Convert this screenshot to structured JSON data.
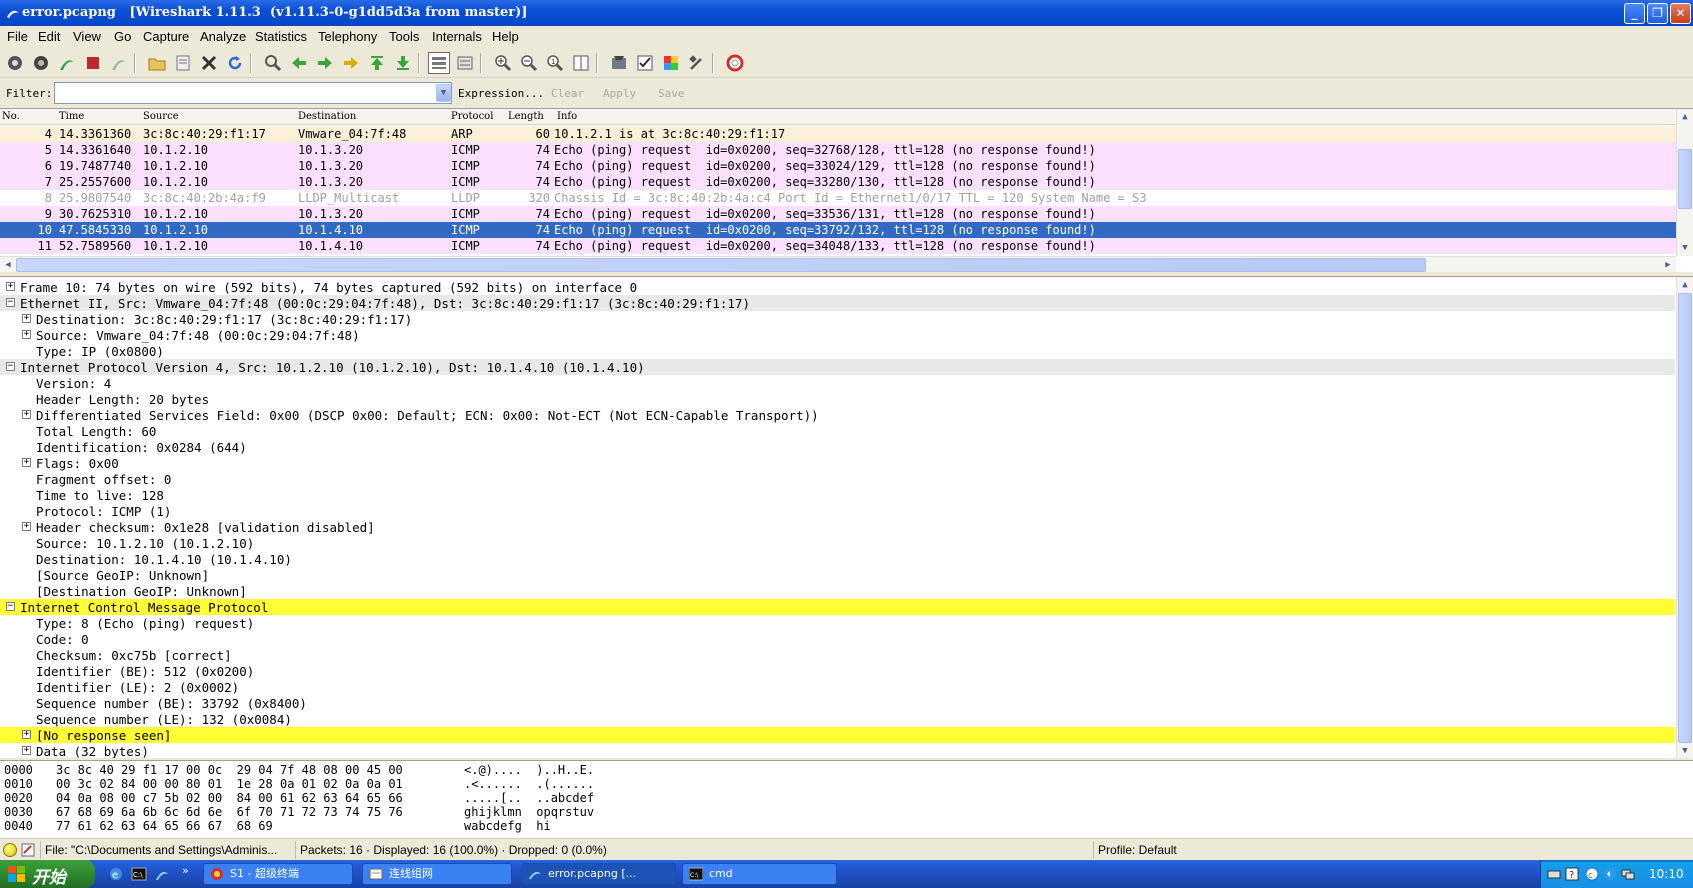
{
  "window": {
    "title": "error.pcapng   [Wireshark 1.11.3  (v1.11.3-0-g1dd5d3a from master)]",
    "controls": [
      "minimize",
      "maximize",
      "close"
    ]
  },
  "menu": [
    "File",
    "Edit",
    "View",
    "Go",
    "Capture",
    "Analyze",
    "Statistics",
    "Telephony",
    "Tools",
    "Internals",
    "Help"
  ],
  "toolbar_icons": [
    "interfaces-icon",
    "options-icon",
    "start-capture-icon",
    "stop-capture-icon",
    "restart-capture-icon",
    "open-file-icon",
    "save-file-icon",
    "close-file-icon",
    "reload-icon",
    "find-packet-icon",
    "go-back-icon",
    "go-forward-icon",
    "go-to-packet-icon",
    "first-packet-icon",
    "last-packet-icon",
    "colorize-icon",
    "auto-scroll-icon",
    "zoom-in-icon",
    "zoom-out-icon",
    "normal-size-icon",
    "resize-columns-icon",
    "capture-filters-icon",
    "display-filters-icon",
    "coloring-rules-icon",
    "preferences-icon",
    "help-icon"
  ],
  "filter": {
    "label": "Filter:",
    "value": "",
    "expression": "Expression...",
    "clear": "Clear",
    "apply": "Apply",
    "save": "Save"
  },
  "packet_list": {
    "columns": [
      "No.",
      "Time",
      "Source",
      "Destination",
      "Protocol",
      "Length",
      "Info"
    ],
    "rows": [
      {
        "no": "4",
        "time": "14.3361360",
        "src": "3c:8c:40:29:f1:17",
        "dst": "Vmware_04:7f:48",
        "proto": "ARP",
        "len": "60",
        "info": "10.1.2.1 is at 3c:8c:40:29:f1:17",
        "kind": "arp"
      },
      {
        "no": "5",
        "time": "14.3361640",
        "src": "10.1.2.10",
        "dst": "10.1.3.20",
        "proto": "ICMP",
        "len": "74",
        "info": "Echo (ping) request  id=0x0200, seq=32768/128, ttl=128 (no response found!)",
        "kind": "icmp"
      },
      {
        "no": "6",
        "time": "19.7487740",
        "src": "10.1.2.10",
        "dst": "10.1.3.20",
        "proto": "ICMP",
        "len": "74",
        "info": "Echo (ping) request  id=0x0200, seq=33024/129, ttl=128 (no response found!)",
        "kind": "icmp"
      },
      {
        "no": "7",
        "time": "25.2557600",
        "src": "10.1.2.10",
        "dst": "10.1.3.20",
        "proto": "ICMP",
        "len": "74",
        "info": "Echo (ping) request  id=0x0200, seq=33280/130, ttl=128 (no response found!)",
        "kind": "icmp"
      },
      {
        "no": "8",
        "time": "25.9807540",
        "src": "3c:8c:40:2b:4a:f9",
        "dst": "LLDP_Multicast",
        "proto": "LLDP",
        "len": "320",
        "info": "Chassis Id = 3c:8c:40:2b:4a:c4 Port Id = Ethernet1/0/17 TTL = 120 System Name = S3",
        "kind": "lldp"
      },
      {
        "no": "9",
        "time": "30.7625310",
        "src": "10.1.2.10",
        "dst": "10.1.3.20",
        "proto": "ICMP",
        "len": "74",
        "info": "Echo (ping) request  id=0x0200, seq=33536/131, ttl=128 (no response found!)",
        "kind": "icmp"
      },
      {
        "no": "10",
        "time": "47.5845330",
        "src": "10.1.2.10",
        "dst": "10.1.4.10",
        "proto": "ICMP",
        "len": "74",
        "info": "Echo (ping) request  id=0x0200, seq=33792/132, ttl=128 (no response found!)",
        "kind": "selected"
      },
      {
        "no": "11",
        "time": "52.7589560",
        "src": "10.1.2.10",
        "dst": "10.1.4.10",
        "proto": "ICMP",
        "len": "74",
        "info": "Echo (ping) request  id=0x0200, seq=34048/133, ttl=128 (no response found!)",
        "kind": "icmp"
      }
    ]
  },
  "detail_tree": [
    {
      "indent": 0,
      "exp": "+",
      "text": "Frame 10: 74 bytes on wire (592 bits), 74 bytes captured (592 bits) on interface 0",
      "style": ""
    },
    {
      "indent": 0,
      "exp": "-",
      "text": "Ethernet II, Src: Vmware_04:7f:48 (00:0c:29:04:7f:48), Dst: 3c:8c:40:29:f1:17 (3c:8c:40:29:f1:17)",
      "style": "hdr"
    },
    {
      "indent": 1,
      "exp": "+",
      "text": "Destination: 3c:8c:40:29:f1:17 (3c:8c:40:29:f1:17)",
      "style": ""
    },
    {
      "indent": 1,
      "exp": "+",
      "text": "Source: Vmware_04:7f:48 (00:0c:29:04:7f:48)",
      "style": ""
    },
    {
      "indent": 1,
      "exp": "",
      "text": "Type: IP (0x0800)",
      "style": ""
    },
    {
      "indent": 0,
      "exp": "-",
      "text": "Internet Protocol Version 4, Src: 10.1.2.10 (10.1.2.10), Dst: 10.1.4.10 (10.1.4.10)",
      "style": "hdr"
    },
    {
      "indent": 1,
      "exp": "",
      "text": "Version: 4",
      "style": ""
    },
    {
      "indent": 1,
      "exp": "",
      "text": "Header Length: 20 bytes",
      "style": ""
    },
    {
      "indent": 1,
      "exp": "+",
      "text": "Differentiated Services Field: 0x00 (DSCP 0x00: Default; ECN: 0x00: Not-ECT (Not ECN-Capable Transport))",
      "style": ""
    },
    {
      "indent": 1,
      "exp": "",
      "text": "Total Length: 60",
      "style": ""
    },
    {
      "indent": 1,
      "exp": "",
      "text": "Identification: 0x0284 (644)",
      "style": ""
    },
    {
      "indent": 1,
      "exp": "+",
      "text": "Flags: 0x00",
      "style": ""
    },
    {
      "indent": 1,
      "exp": "",
      "text": "Fragment offset: 0",
      "style": ""
    },
    {
      "indent": 1,
      "exp": "",
      "text": "Time to live: 128",
      "style": ""
    },
    {
      "indent": 1,
      "exp": "",
      "text": "Protocol: ICMP (1)",
      "style": ""
    },
    {
      "indent": 1,
      "exp": "+",
      "text": "Header checksum: 0x1e28 [validation disabled]",
      "style": ""
    },
    {
      "indent": 1,
      "exp": "",
      "text": "Source: 10.1.2.10 (10.1.2.10)",
      "style": ""
    },
    {
      "indent": 1,
      "exp": "",
      "text": "Destination: 10.1.4.10 (10.1.4.10)",
      "style": ""
    },
    {
      "indent": 1,
      "exp": "",
      "text": "[Source GeoIP: Unknown]",
      "style": ""
    },
    {
      "indent": 1,
      "exp": "",
      "text": "[Destination GeoIP: Unknown]",
      "style": ""
    },
    {
      "indent": 0,
      "exp": "-",
      "text": "Internet Control Message Protocol",
      "style": "warn"
    },
    {
      "indent": 1,
      "exp": "",
      "text": "Type: 8 (Echo (ping) request)",
      "style": ""
    },
    {
      "indent": 1,
      "exp": "",
      "text": "Code: 0",
      "style": ""
    },
    {
      "indent": 1,
      "exp": "",
      "text": "Checksum: 0xc75b [correct]",
      "style": ""
    },
    {
      "indent": 1,
      "exp": "",
      "text": "Identifier (BE): 512 (0x0200)",
      "style": ""
    },
    {
      "indent": 1,
      "exp": "",
      "text": "Identifier (LE): 2 (0x0002)",
      "style": ""
    },
    {
      "indent": 1,
      "exp": "",
      "text": "Sequence number (BE): 33792 (0x8400)",
      "style": ""
    },
    {
      "indent": 1,
      "exp": "",
      "text": "Sequence number (LE): 132 (0x0084)",
      "style": ""
    },
    {
      "indent": 1,
      "exp": "+",
      "text": "[No response seen]",
      "style": "warn"
    },
    {
      "indent": 1,
      "exp": "+",
      "text": "Data (32 bytes)",
      "style": ""
    }
  ],
  "hex_dump": [
    {
      "offset": "0000",
      "hex": "3c 8c 40 29 f1 17 00 0c  29 04 7f 48 08 00 45 00",
      "ascii": "<.@)....  )..H..E."
    },
    {
      "offset": "0010",
      "hex": "00 3c 02 84 00 00 80 01  1e 28 0a 01 02 0a 0a 01",
      "ascii": ".<......  .(......"
    },
    {
      "offset": "0020",
      "hex": "04 0a 08 00 c7 5b 02 00  84 00 61 62 63 64 65 66",
      "ascii": ".....[..  ..abcdef"
    },
    {
      "offset": "0030",
      "hex": "67 68 69 6a 6b 6c 6d 6e  6f 70 71 72 73 74 75 76",
      "ascii": "ghijklmn  opqrstuv"
    },
    {
      "offset": "0040",
      "hex": "77 61 62 63 64 65 66 67  68 69",
      "ascii": "wabcdefg  hi"
    }
  ],
  "status": {
    "file": "File: \"C:\\Documents and Settings\\Adminis...",
    "packets": "Packets: 16 · Displayed: 16 (100.0%)  · Dropped: 0 (0.0%)",
    "profile": "Profile: Default"
  },
  "taskbar": {
    "start": "开始",
    "tasks": [
      {
        "label": "S1 - 超级终端",
        "icon": "hyperterminal-icon",
        "active": false
      },
      {
        "label": "连线组网",
        "icon": "network-icon",
        "active": false
      },
      {
        "label": "error.pcapng   [...",
        "icon": "wireshark-icon",
        "active": true
      },
      {
        "label": "cmd",
        "icon": "cmd-icon",
        "active": false
      }
    ],
    "clock": "10:10"
  },
  "colors": {
    "arp_row": "#faf0d7",
    "icmp_row": "#fce0ff",
    "selected_row": "#316ac5",
    "warn_highlight": "#ffff33",
    "title_bar": "#0a4fd6"
  }
}
